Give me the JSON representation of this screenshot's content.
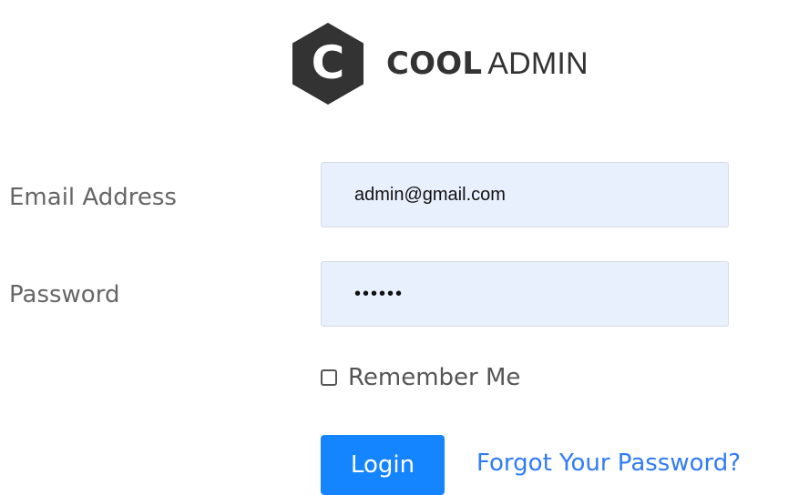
{
  "brand": {
    "mark_letter": "C",
    "name_bold": "COOL",
    "name_regular": "ADMIN"
  },
  "form": {
    "email_label": "Email Address",
    "email_value": "admin@gmail.com",
    "password_label": "Password",
    "password_value": "••••••",
    "remember_label": "Remember Me",
    "remember_checked": false,
    "login_label": "Login",
    "forgot_label": "Forgot Your Password?"
  },
  "colors": {
    "input_background": "#e8f0fe",
    "primary_button": "#1584ff",
    "link": "#2f7cf6",
    "logo": "#333333"
  },
  "icons": {
    "logo": "hexagon-c-logo",
    "checkbox": "checkbox-icon"
  }
}
